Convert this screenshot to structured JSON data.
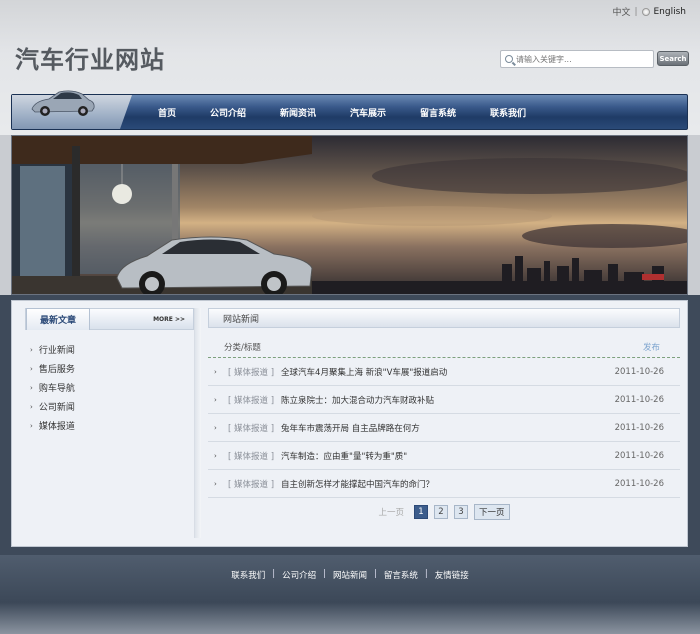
{
  "lang": {
    "zh": "中文",
    "separator": "|",
    "en": "English"
  },
  "site": {
    "title": "汽车行业网站"
  },
  "search": {
    "placeholder": "请输入关键字...",
    "button": "Search"
  },
  "nav": {
    "items": [
      {
        "label": "首页"
      },
      {
        "label": "公司介绍"
      },
      {
        "label": "新闻资讯"
      },
      {
        "label": "汽车展示"
      },
      {
        "label": "留言系统"
      },
      {
        "label": "联系我们"
      }
    ]
  },
  "sidebar": {
    "title": "最新文章",
    "more": "MORE >>",
    "items": [
      {
        "label": "行业新闻"
      },
      {
        "label": "售后服务"
      },
      {
        "label": "购车导航"
      },
      {
        "label": "公司新闻"
      },
      {
        "label": "媒体报道"
      }
    ]
  },
  "main": {
    "title": "网站新闻",
    "col_category": "分类/标题",
    "col_date": "发布",
    "rows": [
      {
        "category": "[ 媒体报道 ]",
        "title": "全球汽车4月聚集上海 新浪\"V车展\"报道启动",
        "date": "2011-10-26"
      },
      {
        "category": "[ 媒体报道 ]",
        "title": "陈立泉院士：加大混合动力汽车财政补贴",
        "date": "2011-10-26"
      },
      {
        "category": "[ 媒体报道 ]",
        "title": "兔年车市震荡开局 自主品牌路在何方",
        "date": "2011-10-26"
      },
      {
        "category": "[ 媒体报道 ]",
        "title": "汽车制造：应由重\"量\"转为重\"质\"",
        "date": "2011-10-26"
      },
      {
        "category": "[ 媒体报道 ]",
        "title": "自主创新怎样才能撑起中国汽车的命门？",
        "date": "2011-10-26"
      }
    ],
    "pager": {
      "prev": "上一页",
      "pages": [
        "1",
        "2",
        "3"
      ],
      "next": "下一页"
    }
  },
  "footer": {
    "links": [
      {
        "label": "联系我们"
      },
      {
        "label": "公司介绍"
      },
      {
        "label": "网站新闻"
      },
      {
        "label": "留言系统"
      },
      {
        "label": "友情链接"
      }
    ],
    "separator": "|"
  },
  "colors": {
    "nav_dark": "#1f3b66",
    "band": "#3e4a5a",
    "content_bg": "#eef1f6",
    "active_page": "#3c5d8c"
  }
}
